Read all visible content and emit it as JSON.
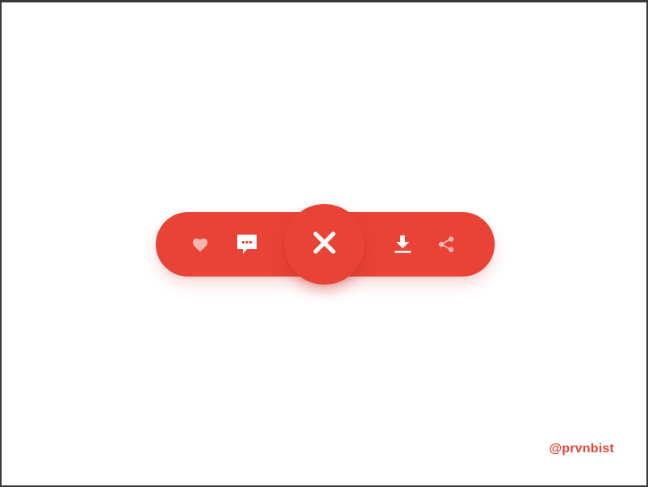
{
  "colors": {
    "accent": "#e84336",
    "icon_primary": "#ffffff",
    "icon_muted": "#f6b6b0",
    "frame": "#3a3a3a",
    "background": "#ffffff"
  },
  "action_bar": {
    "actions": [
      {
        "id": "like",
        "icon": "heart-icon"
      },
      {
        "id": "comment",
        "icon": "comment-icon"
      },
      {
        "id": "download",
        "icon": "download-icon"
      },
      {
        "id": "share",
        "icon": "share-icon"
      }
    ],
    "fab": {
      "icon": "close-icon"
    }
  },
  "credit": {
    "handle": "@prvnbist"
  }
}
